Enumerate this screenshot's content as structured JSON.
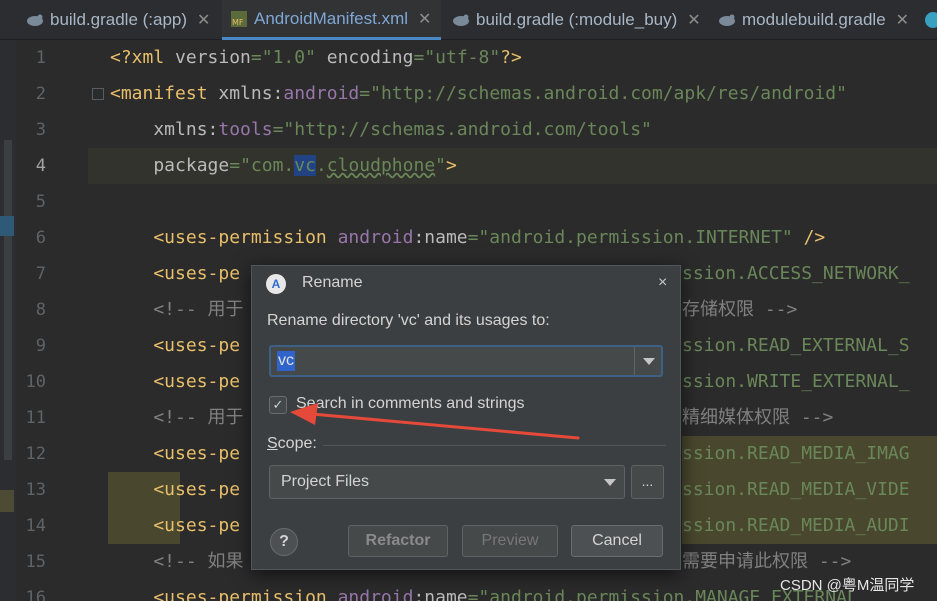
{
  "tabs": [
    {
      "label": "build.gradle (:app)",
      "icon": "gradle-icon",
      "active": false
    },
    {
      "label": "AndroidManifest.xml",
      "icon": "manifest-icon",
      "active": true
    },
    {
      "label": "build.gradle (:module_buy)",
      "icon": "gradle-icon",
      "active": false
    },
    {
      "label": "modulebuild.gradle",
      "icon": "gradle-icon",
      "active": false
    }
  ],
  "editor": {
    "line_numbers": [
      "1",
      "2",
      "3",
      "4",
      "5",
      "6",
      "7",
      "8",
      "9",
      "10",
      "11",
      "12",
      "13",
      "14",
      "15",
      "16"
    ],
    "current_line": "4",
    "lines": {
      "l1_a": "<?xml ",
      "l1_b": "version",
      "l1_c": "=",
      "l1_d": "\"1.0\"",
      "l1_e": " encoding",
      "l1_f": "=",
      "l1_g": "\"utf-8\"",
      "l1_h": "?>",
      "l2_a": "<manifest ",
      "l2_b": "xmlns:",
      "l2_c": "android",
      "l2_d": "=",
      "l2_e": "\"http://schemas.android.com/apk/res/android\"",
      "l3_a": "    xmlns:",
      "l3_b": "tools",
      "l3_c": "=",
      "l3_d": "\"http://schemas.android.com/tools\"",
      "l4_a": "    package",
      "l4_b": "=",
      "l4_c": "\"com.",
      "l4_d": "vc",
      "l4_e": ".",
      "l4_f": "cloudphone",
      "l4_g": "\"",
      "l4_h": ">",
      "l6_a": "    <uses-permission ",
      "l6_b": "android",
      "l6_c": ":name",
      "l6_d": "=",
      "l6_e": "\"android.permission.INTERNET\"",
      "l6_f": " />",
      "l7_a": "    <uses-pe",
      "l7_b": "ssion.ACCESS_NETWORK_",
      "l8_a": "    <!-- 用于",
      "l8_b": "存储权限 -->",
      "l9_a": "    <uses-pe",
      "l9_b": "ssion.READ_EXTERNAL_S",
      "l10_a": "    <uses-pe",
      "l10_b": "ssion.WRITE_EXTERNAL_",
      "l11_a": "    <!-- 用于",
      "l11_b": "精细媒体权限 -->",
      "l12_a": "    <uses-pe",
      "l12_b": "ssion.READ_MEDIA_IMAG",
      "l13_a": "    <uses-pe",
      "l13_b": "ssion.READ_MEDIA_VIDE",
      "l14_a": "    <uses-pe",
      "l14_b": "ssion.READ_MEDIA_AUDI",
      "l15_a": "    <!-- 如果",
      "l15_b": "需要申请此权限 -->",
      "l16_a": "    <uses-permission ",
      "l16_b": "android",
      "l16_c": ":name",
      "l16_d": "=",
      "l16_e": "\"android.permission.MANAGE_EXTERNAL"
    }
  },
  "dialog": {
    "title": "Rename",
    "prompt": "Rename directory 'vc' and its usages to:",
    "new_name": "vc",
    "search_in_comments_label": "Search in comments and strings",
    "search_in_comments_checked": true,
    "scope_label_underlined": "S",
    "scope_label_rest": "cope:",
    "scope_value": "Project Files",
    "more_button": "...",
    "help_button": "?",
    "refactor_button": "Refactor",
    "preview_button": "Preview",
    "cancel_button": "Cancel",
    "close_icon": "×"
  },
  "annotation": {
    "color": "#e5493a"
  },
  "watermark": "CSDN @粤M温同学"
}
